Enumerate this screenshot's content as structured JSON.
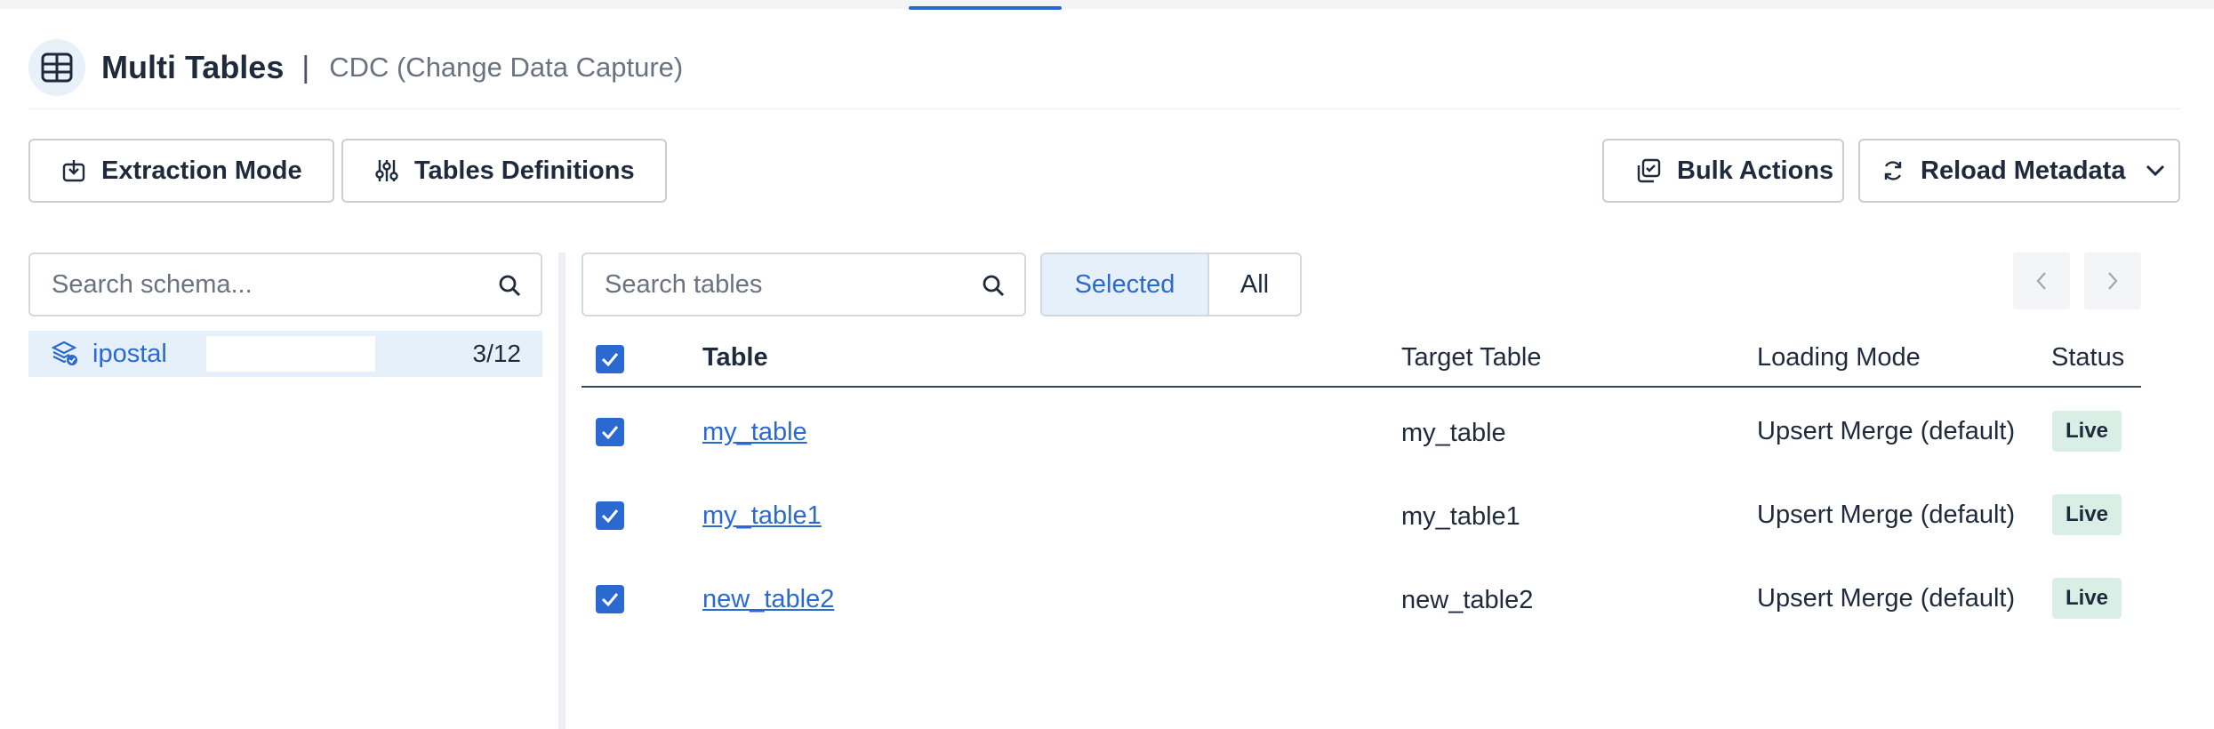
{
  "header": {
    "title": "Multi Tables",
    "separator": "|",
    "subtitle": "CDC (Change Data Capture)",
    "icon": "table-columns-icon"
  },
  "toolbar": {
    "extraction_mode_label": "Extraction Mode",
    "tables_definitions_label": "Tables Definitions",
    "bulk_actions_label": "Bulk Actions",
    "reload_metadata_label": "Reload Metadata"
  },
  "schema_panel": {
    "search_placeholder": "Search schema...",
    "schemas": [
      {
        "name": "ipostal",
        "count": "3/12",
        "icon": "schema-layers-icon"
      }
    ]
  },
  "tables_panel": {
    "search_placeholder": "Search tables",
    "filter": {
      "selected_label": "Selected",
      "all_label": "All",
      "active": "Selected"
    },
    "columns": {
      "table": "Table",
      "target_table": "Target Table",
      "loading_mode": "Loading Mode",
      "status": "Status"
    },
    "rows": [
      {
        "table": "my_table",
        "target_table": "my_table",
        "loading_mode": "Upsert Merge (default)",
        "status": "Live",
        "checked": true
      },
      {
        "table": "my_table1",
        "target_table": "my_table1",
        "loading_mode": "Upsert Merge (default)",
        "status": "Live",
        "checked": true
      },
      {
        "table": "new_table2",
        "target_table": "new_table2",
        "loading_mode": "Upsert Merge (default)",
        "status": "Live",
        "checked": true
      }
    ]
  },
  "colors": {
    "accent": "#2a6ad0",
    "selected_bg": "#e6f0fa",
    "status_live_bg": "#d9efe6",
    "text": "#1f2a3c"
  }
}
